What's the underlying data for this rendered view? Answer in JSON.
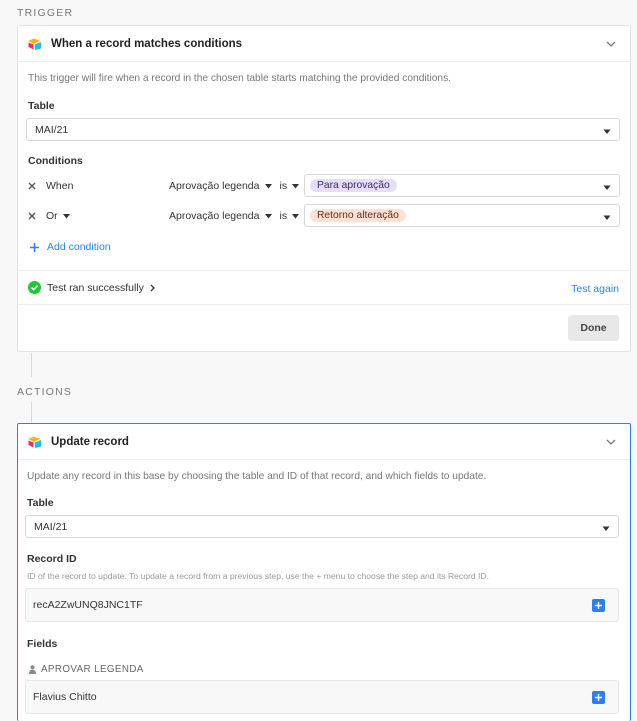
{
  "trigger": {
    "section_label": "TRIGGER",
    "title": "When a record matches conditions",
    "description": "This trigger will fire when a record in the chosen table starts matching the provided conditions.",
    "table_label": "Table",
    "table_value": "MAI/21",
    "conditions_label": "Conditions",
    "conditions": [
      {
        "conjunction": "When",
        "field": "Aprovação legenda",
        "operator": "is",
        "value": "Para aprovação",
        "value_bg": "#e6ddfa",
        "value_color": "#3a2a6b"
      },
      {
        "conjunction": "Or",
        "field": "Aprovação legenda",
        "operator": "is",
        "value": "Retorno alteração",
        "value_bg": "#fde0d6",
        "value_color": "#6b2b17"
      }
    ],
    "add_condition_label": "Add condition",
    "test_status": "Test ran successfully",
    "test_again_label": "Test again",
    "done_label": "Done"
  },
  "actions": {
    "section_label": "ACTIONS",
    "title": "Update record",
    "description": "Update any record in this base by choosing the table and ID of that record, and which fields to update.",
    "table_label": "Table",
    "table_value": "MAI/21",
    "record_id_label": "Record ID",
    "record_id_help": "ID of the record to update. To update a record from a previous step, use the + menu to choose the step and its Record ID.",
    "record_id_value": "recA2ZwUNQ8JNC1TF",
    "fields_label": "Fields",
    "field_name": "APROVAR LEGENDA",
    "field_value": "Flavius Chitto"
  },
  "colors": {
    "accent_blue": "#2d7ff9",
    "success_green": "#20c933"
  }
}
